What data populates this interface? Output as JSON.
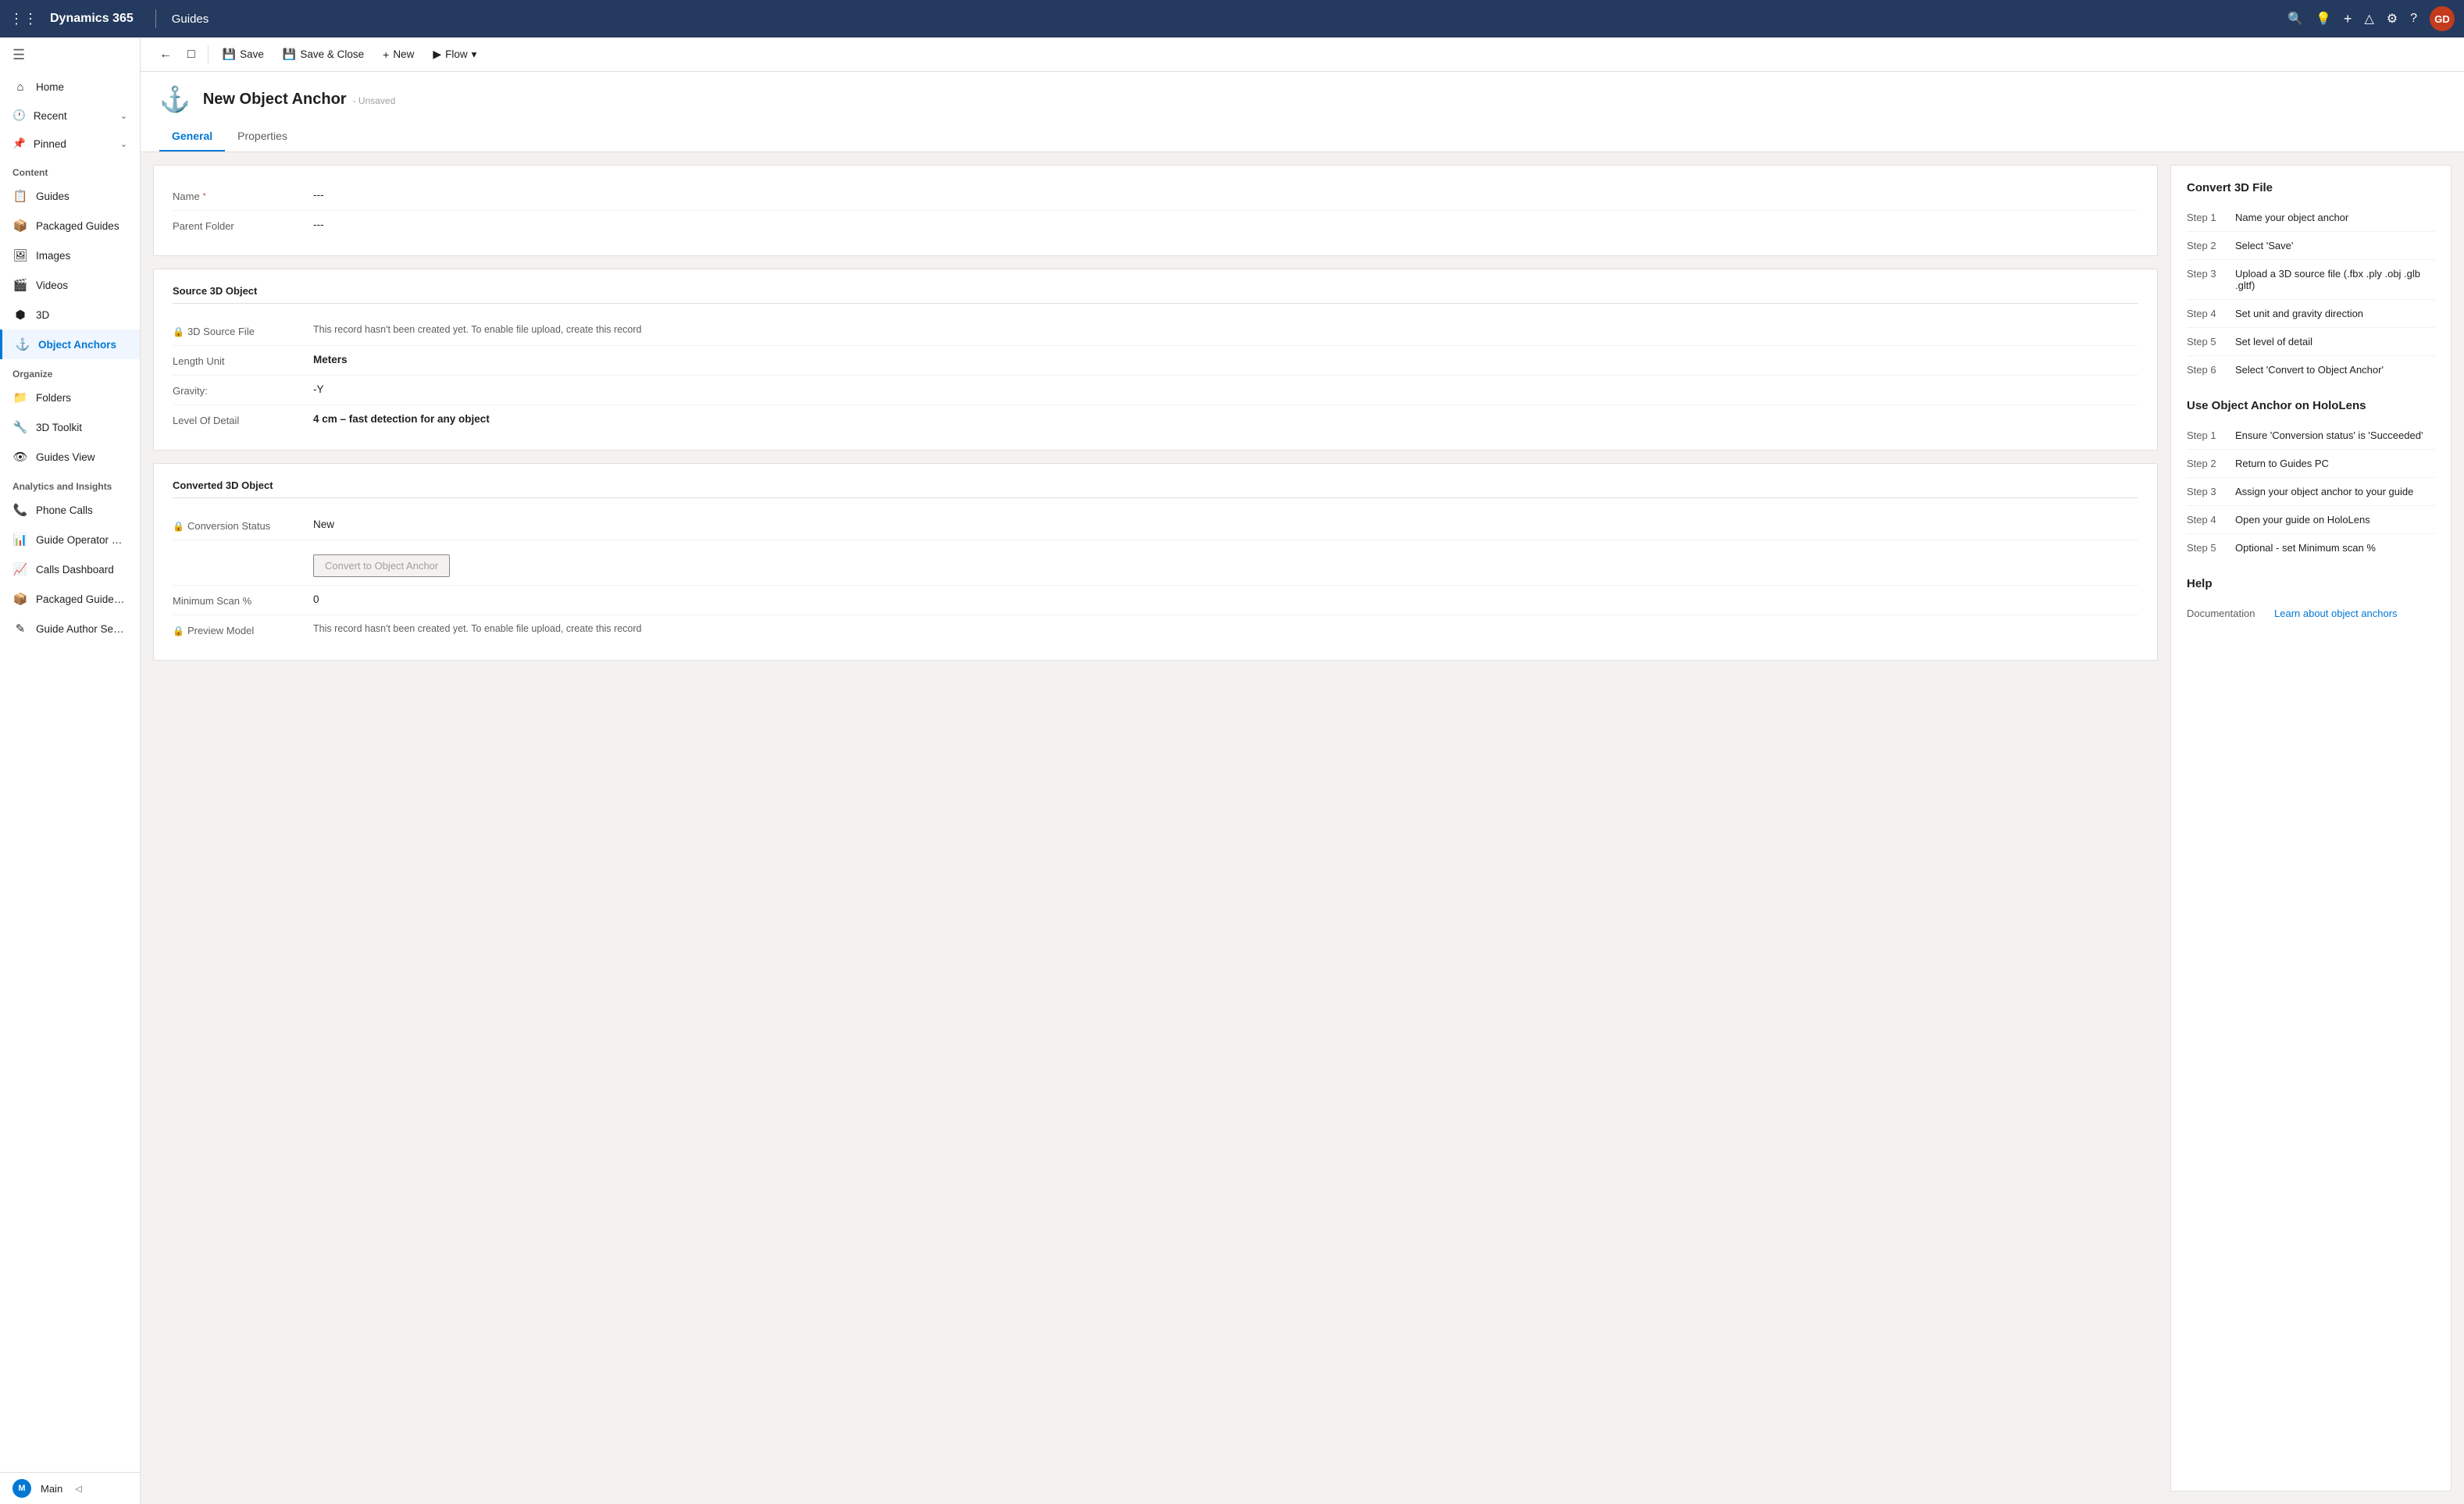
{
  "topNav": {
    "gridIcon": "⊞",
    "appName": "Dynamics 365",
    "divider": true,
    "subApp": "Guides",
    "icons": {
      "search": "🔍",
      "lightbulb": "💡",
      "plus": "+",
      "filter": "⧗",
      "settings": "⚙",
      "help": "?"
    },
    "avatar": "GD"
  },
  "sidebar": {
    "toggleIcon": "☰",
    "items": [
      {
        "id": "home",
        "icon": "⌂",
        "label": "Home",
        "active": false
      },
      {
        "id": "recent",
        "icon": "🕐",
        "label": "Recent",
        "expandable": true,
        "active": false
      },
      {
        "id": "pinned",
        "icon": "📌",
        "label": "Pinned",
        "expandable": true,
        "active": false
      }
    ],
    "sections": [
      {
        "label": "Content",
        "items": [
          {
            "id": "guides",
            "icon": "📋",
            "label": "Guides",
            "active": false
          },
          {
            "id": "packaged-guides",
            "icon": "📦",
            "label": "Packaged Guides",
            "active": false
          },
          {
            "id": "images",
            "icon": "🖼",
            "label": "Images",
            "active": false
          },
          {
            "id": "videos",
            "icon": "🎬",
            "label": "Videos",
            "active": false
          },
          {
            "id": "3d",
            "icon": "🧊",
            "label": "3D",
            "active": false
          },
          {
            "id": "object-anchors",
            "icon": "⚓",
            "label": "Object Anchors",
            "active": true
          }
        ]
      },
      {
        "label": "Organize",
        "items": [
          {
            "id": "folders",
            "icon": "📁",
            "label": "Folders",
            "active": false
          },
          {
            "id": "3d-toolkit",
            "icon": "🔧",
            "label": "3D Toolkit",
            "active": false
          },
          {
            "id": "guides-view",
            "icon": "👁",
            "label": "Guides View",
            "active": false
          }
        ]
      },
      {
        "label": "Analytics and Insights",
        "items": [
          {
            "id": "phone-calls",
            "icon": "📞",
            "label": "Phone Calls",
            "active": false
          },
          {
            "id": "guide-operator",
            "icon": "📊",
            "label": "Guide Operator Sessi...",
            "active": false
          },
          {
            "id": "calls-dashboard",
            "icon": "📈",
            "label": "Calls Dashboard",
            "active": false
          },
          {
            "id": "packaged-guides-op",
            "icon": "📦",
            "label": "Packaged Guides Op...",
            "active": false
          },
          {
            "id": "guide-author",
            "icon": "✍",
            "label": "Guide Author Sessions",
            "active": false
          }
        ]
      }
    ],
    "bottomBar": {
      "icon": "M",
      "label": "Main",
      "chevron": "◁"
    }
  },
  "toolbar": {
    "backIcon": "←",
    "refreshIcon": "⊡",
    "save": "Save",
    "saveAndClose": "Save & Close",
    "new": "New",
    "flow": "Flow",
    "flowChevron": "▾"
  },
  "pageHeader": {
    "icon": "⚓",
    "title": "New Object Anchor",
    "subtitle": "- Unsaved",
    "tabs": [
      {
        "id": "general",
        "label": "General",
        "active": true
      },
      {
        "id": "properties",
        "label": "Properties",
        "active": false
      }
    ]
  },
  "form": {
    "basicSection": {
      "fields": [
        {
          "id": "name",
          "label": "Name",
          "required": true,
          "value": "---",
          "locked": false
        },
        {
          "id": "parent-folder",
          "label": "Parent Folder",
          "required": false,
          "value": "---",
          "locked": false
        }
      ]
    },
    "source3DSection": {
      "title": "Source 3D Object",
      "fields": [
        {
          "id": "3d-source-file",
          "label": "3D Source File",
          "locked": true,
          "value": "This record hasn't been created yet. To enable file upload, create this record",
          "isPlaceholder": true
        },
        {
          "id": "length-unit",
          "label": "Length Unit",
          "value": "Meters",
          "bold": true,
          "locked": false
        },
        {
          "id": "gravity",
          "label": "Gravity:",
          "value": "-Y",
          "locked": false
        },
        {
          "id": "level-of-detail",
          "label": "Level Of Detail",
          "value": "4 cm – fast detection for any object",
          "bold": true,
          "locked": false
        }
      ]
    },
    "converted3DSection": {
      "title": "Converted 3D Object",
      "fields": [
        {
          "id": "conversion-status",
          "label": "Conversion Status",
          "locked": true,
          "value": "New",
          "bold": false
        },
        {
          "id": "convert-btn",
          "label": "",
          "isButton": true,
          "buttonLabel": "Convert to Object Anchor",
          "disabled": true
        },
        {
          "id": "minimum-scan",
          "label": "Minimum Scan %",
          "value": "0",
          "locked": false
        },
        {
          "id": "preview-model",
          "label": "Preview Model",
          "locked": true,
          "value": "This record hasn't been created yet. To enable file upload, create this record",
          "isPlaceholder": true
        }
      ]
    }
  },
  "helpPanel": {
    "convert3DFile": {
      "title": "Convert 3D File",
      "steps": [
        {
          "step": "Step 1",
          "text": "Name your object anchor"
        },
        {
          "step": "Step 2",
          "text": "Select 'Save'"
        },
        {
          "step": "Step 3",
          "text": "Upload a 3D source file (.fbx .ply .obj .glb .gltf)"
        },
        {
          "step": "Step 4",
          "text": "Set unit and gravity direction"
        },
        {
          "step": "Step 5",
          "text": "Set level of detail"
        },
        {
          "step": "Step 6",
          "text": "Select 'Convert to Object Anchor'"
        }
      ]
    },
    "useOnHoloLens": {
      "title": "Use Object Anchor on HoloLens",
      "steps": [
        {
          "step": "Step 1",
          "text": "Ensure 'Conversion status' is 'Succeeded'"
        },
        {
          "step": "Step 2",
          "text": "Return to Guides PC"
        },
        {
          "step": "Step 3",
          "text": "Assign your object anchor to your guide"
        },
        {
          "step": "Step 4",
          "text": "Open your guide on HoloLens"
        },
        {
          "step": "Step 5",
          "text": "Optional - set Minimum scan %"
        }
      ]
    },
    "help": {
      "title": "Help",
      "rows": [
        {
          "label": "Documentation",
          "linkText": "Learn about object anchors",
          "linkHref": "#"
        }
      ]
    }
  }
}
